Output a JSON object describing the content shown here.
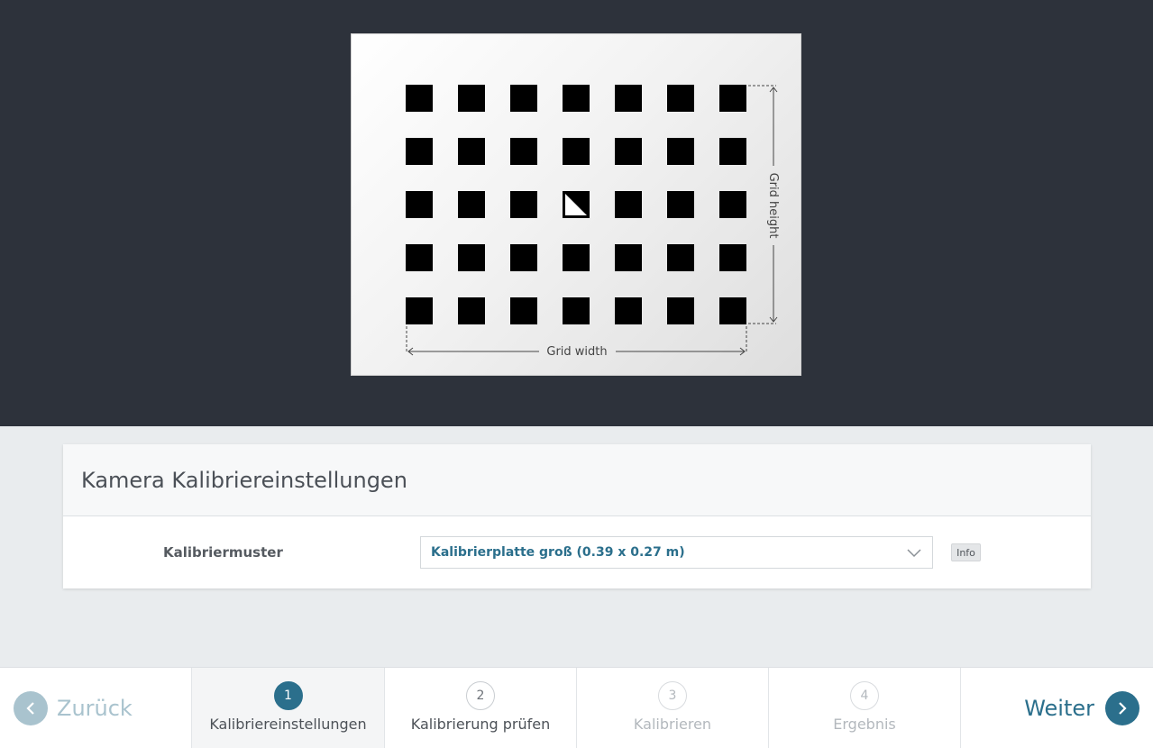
{
  "preview": {
    "grid_columns": 7,
    "grid_rows": 5,
    "marker_row": 3,
    "marker_col": 4,
    "grid_width_label": "Grid width",
    "grid_height_label": "Grid height"
  },
  "settings": {
    "title": "Kamera Kalibriereinstellungen",
    "pattern_label": "Kalibriermuster",
    "pattern_value": "Kalibrierplatte groß (0.39 x 0.27 m)",
    "info_label": "Info"
  },
  "footer": {
    "back_label": "Zurück",
    "next_label": "Weiter",
    "steps": [
      {
        "number": "1",
        "label": "Kalibriereinstellungen",
        "state": "active"
      },
      {
        "number": "2",
        "label": "Kalibrierung prüfen",
        "state": "enabled"
      },
      {
        "number": "3",
        "label": "Kalibrieren",
        "state": "disabled"
      },
      {
        "number": "4",
        "label": "Ergebnis",
        "state": "disabled"
      }
    ]
  },
  "colors": {
    "accent": "#2b6f8c",
    "accent_light": "#a9c3ce",
    "dark_background": "#2d323b"
  }
}
